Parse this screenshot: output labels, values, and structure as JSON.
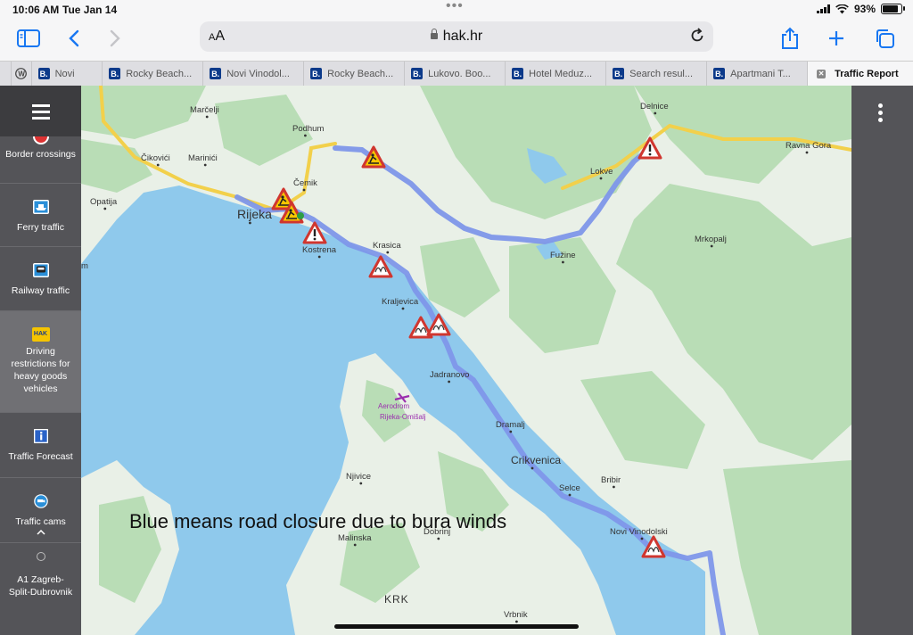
{
  "status": {
    "time": "10:06 AM",
    "date": "Tue Jan 14",
    "battery": "93%",
    "battery_level": 0.93
  },
  "browser": {
    "text_size_label": "A",
    "text_size_label_big": "A",
    "host": "hak.hr"
  },
  "tabs": [
    {
      "label": ""
    },
    {
      "label": "Novi"
    },
    {
      "label": "Rocky Beach..."
    },
    {
      "label": "Novi Vinodol..."
    },
    {
      "label": "Rocky Beach..."
    },
    {
      "label": "Lukovo. Boo..."
    },
    {
      "label": "Hotel Meduz..."
    },
    {
      "label": "Search resul..."
    },
    {
      "label": "Apartmani T..."
    },
    {
      "label": "Traffic Report"
    }
  ],
  "tab_icon_letter": "B.",
  "sidebar": {
    "items": [
      {
        "label": "Border crossings"
      },
      {
        "label": "Ferry traffic"
      },
      {
        "label": "Railway traffic"
      },
      {
        "label": "Driving restrictions for heavy goods vehicles",
        "badge": "HAK"
      },
      {
        "label": "Traffic Forecast"
      },
      {
        "label": "Traffic cams"
      },
      {
        "label": "A1 Zagreb-Split-Dubrovnik"
      }
    ]
  },
  "map": {
    "annotation": "Blue means road closure due to bura winds",
    "places": [
      "Marčelji",
      "Podhum",
      "Delnice",
      "Čikovići",
      "Marinići",
      "Ravna Gora",
      "Lokve",
      "Čemik",
      "Opatija",
      "Rijeka",
      "Kostrena",
      "Krasica",
      "Mrkopalj",
      "Fužine",
      "Kraljevica",
      "Jadranovo",
      "Aerodrom",
      "Rijeka-Omišalj",
      "Dramalj",
      "Crikvenica",
      "Bribir",
      "Selce",
      "Njivice",
      "Novi Vinodolski",
      "Malinska",
      "Dobrinj",
      "KRK",
      "Vrbnik",
      "m"
    ],
    "colors": {
      "water": "#8fc9ec",
      "land": "#e8efe6",
      "forest": "#b7dcb3",
      "closure": "#7f97ea",
      "highway": "#f2d04b",
      "warning_red": "#d0362f"
    }
  }
}
